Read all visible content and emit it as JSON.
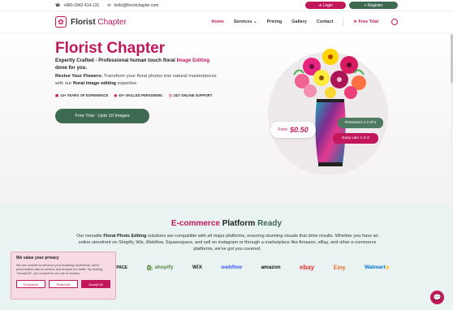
{
  "topbar": {
    "phone": "+880-1842-414-131",
    "email": "hello@floristchapter.com",
    "login_label": "Login",
    "register_label": "Register"
  },
  "nav": {
    "brand_first": "Florist",
    "brand_second": "Chapter",
    "items": [
      "Home",
      "Services",
      "Pricing",
      "Gallery",
      "Contact"
    ],
    "free_trial": "Free Trial"
  },
  "hero": {
    "title": "Florist Chapter",
    "subtitle_start": "Expertly Crafted - Professional human touch floral ",
    "subtitle_highlight": "Image Editing",
    "subtitle_end": " done for you.",
    "desc_bold": "Revive Your Flowers:",
    "desc_text": " Transform your floral photos into natural masterpieces with our ",
    "desc_bold2": "floral image editing",
    "desc_end": " expertise.",
    "features": [
      "14+ YEARS OF EXPERIENCE",
      "40+ SKILLED PERSONNEL",
      "24/7 ONLINE SUPPORT"
    ],
    "cta": "Free Trial - Upto 10 Images",
    "price_from": "From",
    "price_value": "$0.50",
    "reviewed": "Reviewed 4.3 of 5",
    "easy": "Easy Like 1-2-3"
  },
  "eco": {
    "title_1": "E-commerce",
    "title_2": "Platform",
    "title_3": "Ready",
    "desc_start": "Our versatile ",
    "desc_bold": "Floral Photo Editing",
    "desc_rest": " solutions are compatible with all major platforms, ensuring stunning visuals that drive results. Whether you have an online storefront on Shopify, Wix, Webflow, Squarespace, and sell on instagram or through a marketplace like Amazon, eBay, and other e-commerce platforms, we've got you covered.",
    "logos": [
      "SPACE",
      "shopify",
      "WiX",
      "webflow",
      "amazon",
      "ebay",
      "Etsy",
      "Walmart"
    ]
  },
  "cookie": {
    "title": "We value your privacy",
    "text": "We use cookies to enhance your browsing experience, serve personalized ads or content, and analyze our traffic. By clicking \"Accept All\", you consent to our use of cookies.",
    "customize": "Customize",
    "reject": "Reject All",
    "accept": "Accept All"
  },
  "colors": {
    "brand": "#c2185b",
    "green": "#3f6a52",
    "eco_bg": "#e8f3f2"
  }
}
